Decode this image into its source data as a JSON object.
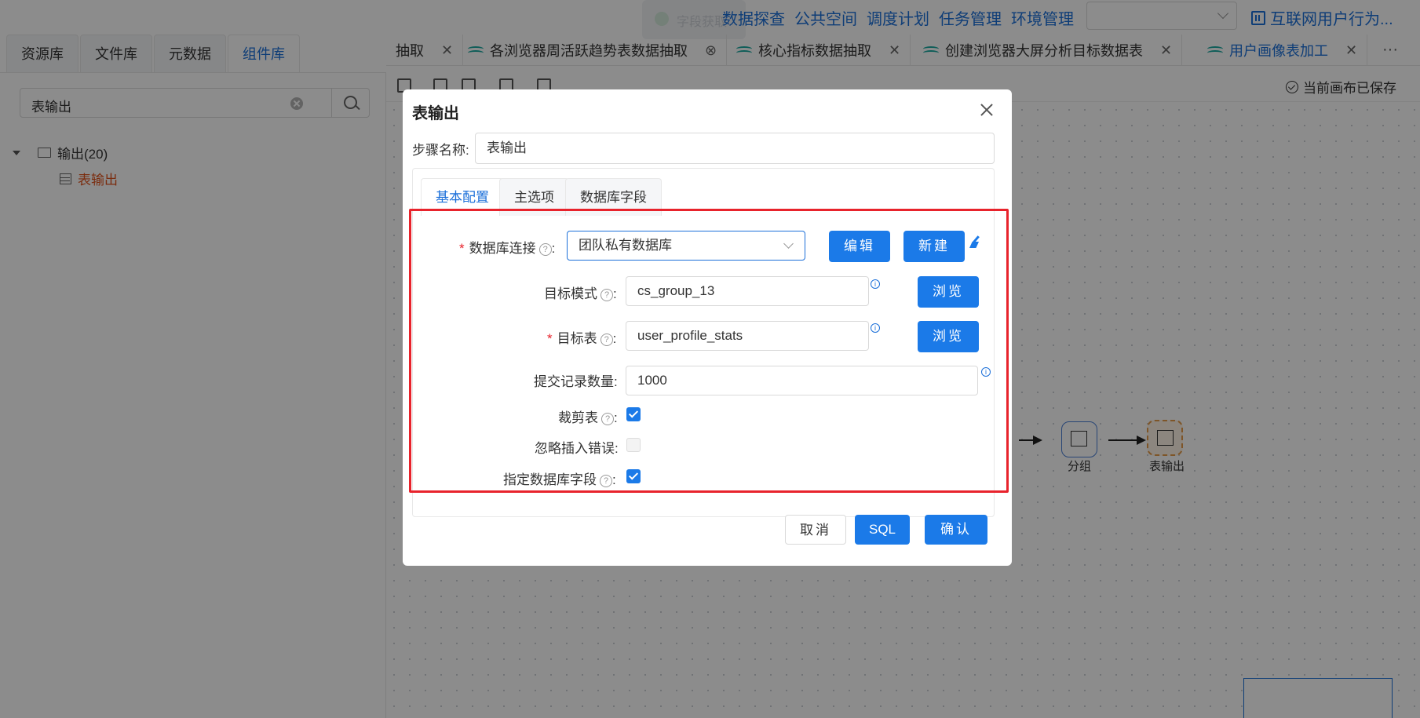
{
  "topnav": {
    "toast_text": "字段获取",
    "links": [
      "数据探查",
      "公共空间",
      "调度计划",
      "任务管理",
      "环境管理"
    ],
    "project": "互联网用户行为..."
  },
  "left": {
    "tabs": [
      "资源库",
      "文件库",
      "元数据",
      "组件库"
    ],
    "search_value": "表输出",
    "tree_folder": "输出(20)",
    "tree_item": "表输出"
  },
  "editor_tabs": [
    {
      "label": "抽取"
    },
    {
      "label": "各浏览器周活跃趋势表数据抽取"
    },
    {
      "label": "核心指标数据抽取"
    },
    {
      "label": "创建浏览器大屏分析目标数据表"
    },
    {
      "label": "用户画像表加工"
    }
  ],
  "toolbar": {
    "saved": "当前画布已保存"
  },
  "canvas": {
    "node_group": "分组",
    "node_output": "表输出",
    "more": "···"
  },
  "modal": {
    "title": "表输出",
    "step_label": "步骤名称:",
    "step_value": "表输出",
    "tabs": [
      "基本配置",
      "主选项",
      "数据库字段"
    ],
    "fields": {
      "db_conn_label": "数据库连接",
      "db_conn_value": "团队私有数据库",
      "edit_btn": "编辑",
      "new_btn": "新建",
      "schema_label": "目标模式",
      "schema_value": "cs_group_13",
      "browse_btn": "浏览",
      "table_label": "目标表",
      "table_value": "user_profile_stats",
      "commit_label": "提交记录数量",
      "commit_value": "1000",
      "truncate_label": "裁剪表",
      "ignore_label": "忽略插入错误",
      "specify_label": "指定数据库字段",
      "truncate_checked": true,
      "ignore_checked": false,
      "specify_checked": true
    },
    "footer": {
      "cancel": "取消",
      "sql": "SQL",
      "ok": "确认"
    }
  },
  "colors": {
    "accent": "#1b7ae8",
    "highlight_border": "#e8232c",
    "link": "#1b6fd9"
  }
}
